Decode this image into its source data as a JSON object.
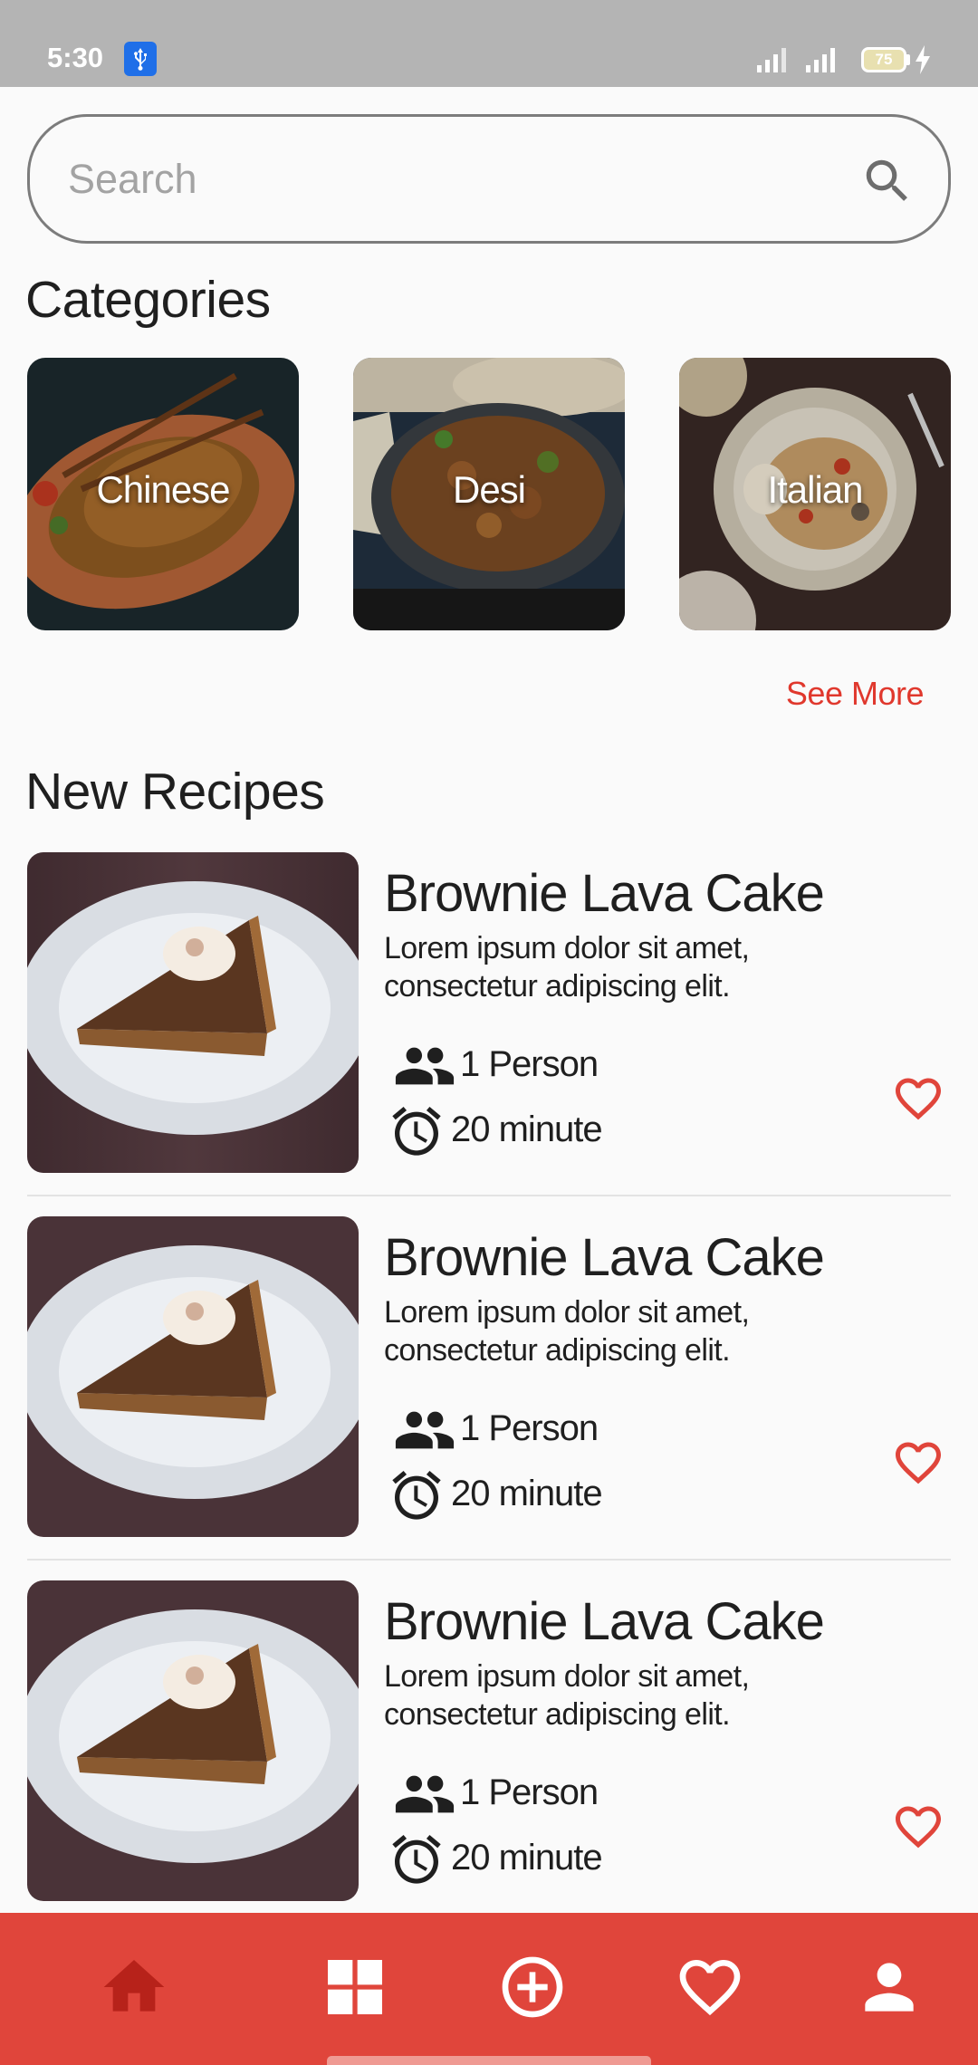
{
  "status_bar": {
    "time": "5:30",
    "battery": "75"
  },
  "search": {
    "placeholder": "Search"
  },
  "categories_section": {
    "title": "Categories",
    "items": [
      {
        "label": "Chinese"
      },
      {
        "label": "Desi"
      },
      {
        "label": "Italian"
      }
    ],
    "see_more": "See More"
  },
  "recipes_section": {
    "title": "New Recipes",
    "items": [
      {
        "title": "Brownie Lava Cake",
        "description": "Lorem ipsum dolor sit amet, consectetur adipiscing elit.",
        "servings": "1 Person",
        "time": "20 minute"
      },
      {
        "title": "Brownie Lava Cake",
        "description": "Lorem ipsum dolor sit amet, consectetur adipiscing elit.",
        "servings": "1 Person",
        "time": "20 minute"
      },
      {
        "title": "Brownie Lava Cake",
        "description": "Lorem ipsum dolor sit amet, consectetur adipiscing elit.",
        "servings": "1 Person",
        "time": "20 minute"
      }
    ]
  },
  "bottom_nav": {
    "items": [
      {
        "icon": "home-icon",
        "active": true
      },
      {
        "icon": "grid-icon",
        "active": false
      },
      {
        "icon": "add-circle-icon",
        "active": false
      },
      {
        "icon": "heart-icon",
        "active": false
      },
      {
        "icon": "person-icon",
        "active": false
      }
    ]
  },
  "colors": {
    "accent": "#e0453b",
    "active_nav_icon": "#b7221a",
    "status_bar": "#b4b4b4",
    "see_more": "#e0382d"
  }
}
